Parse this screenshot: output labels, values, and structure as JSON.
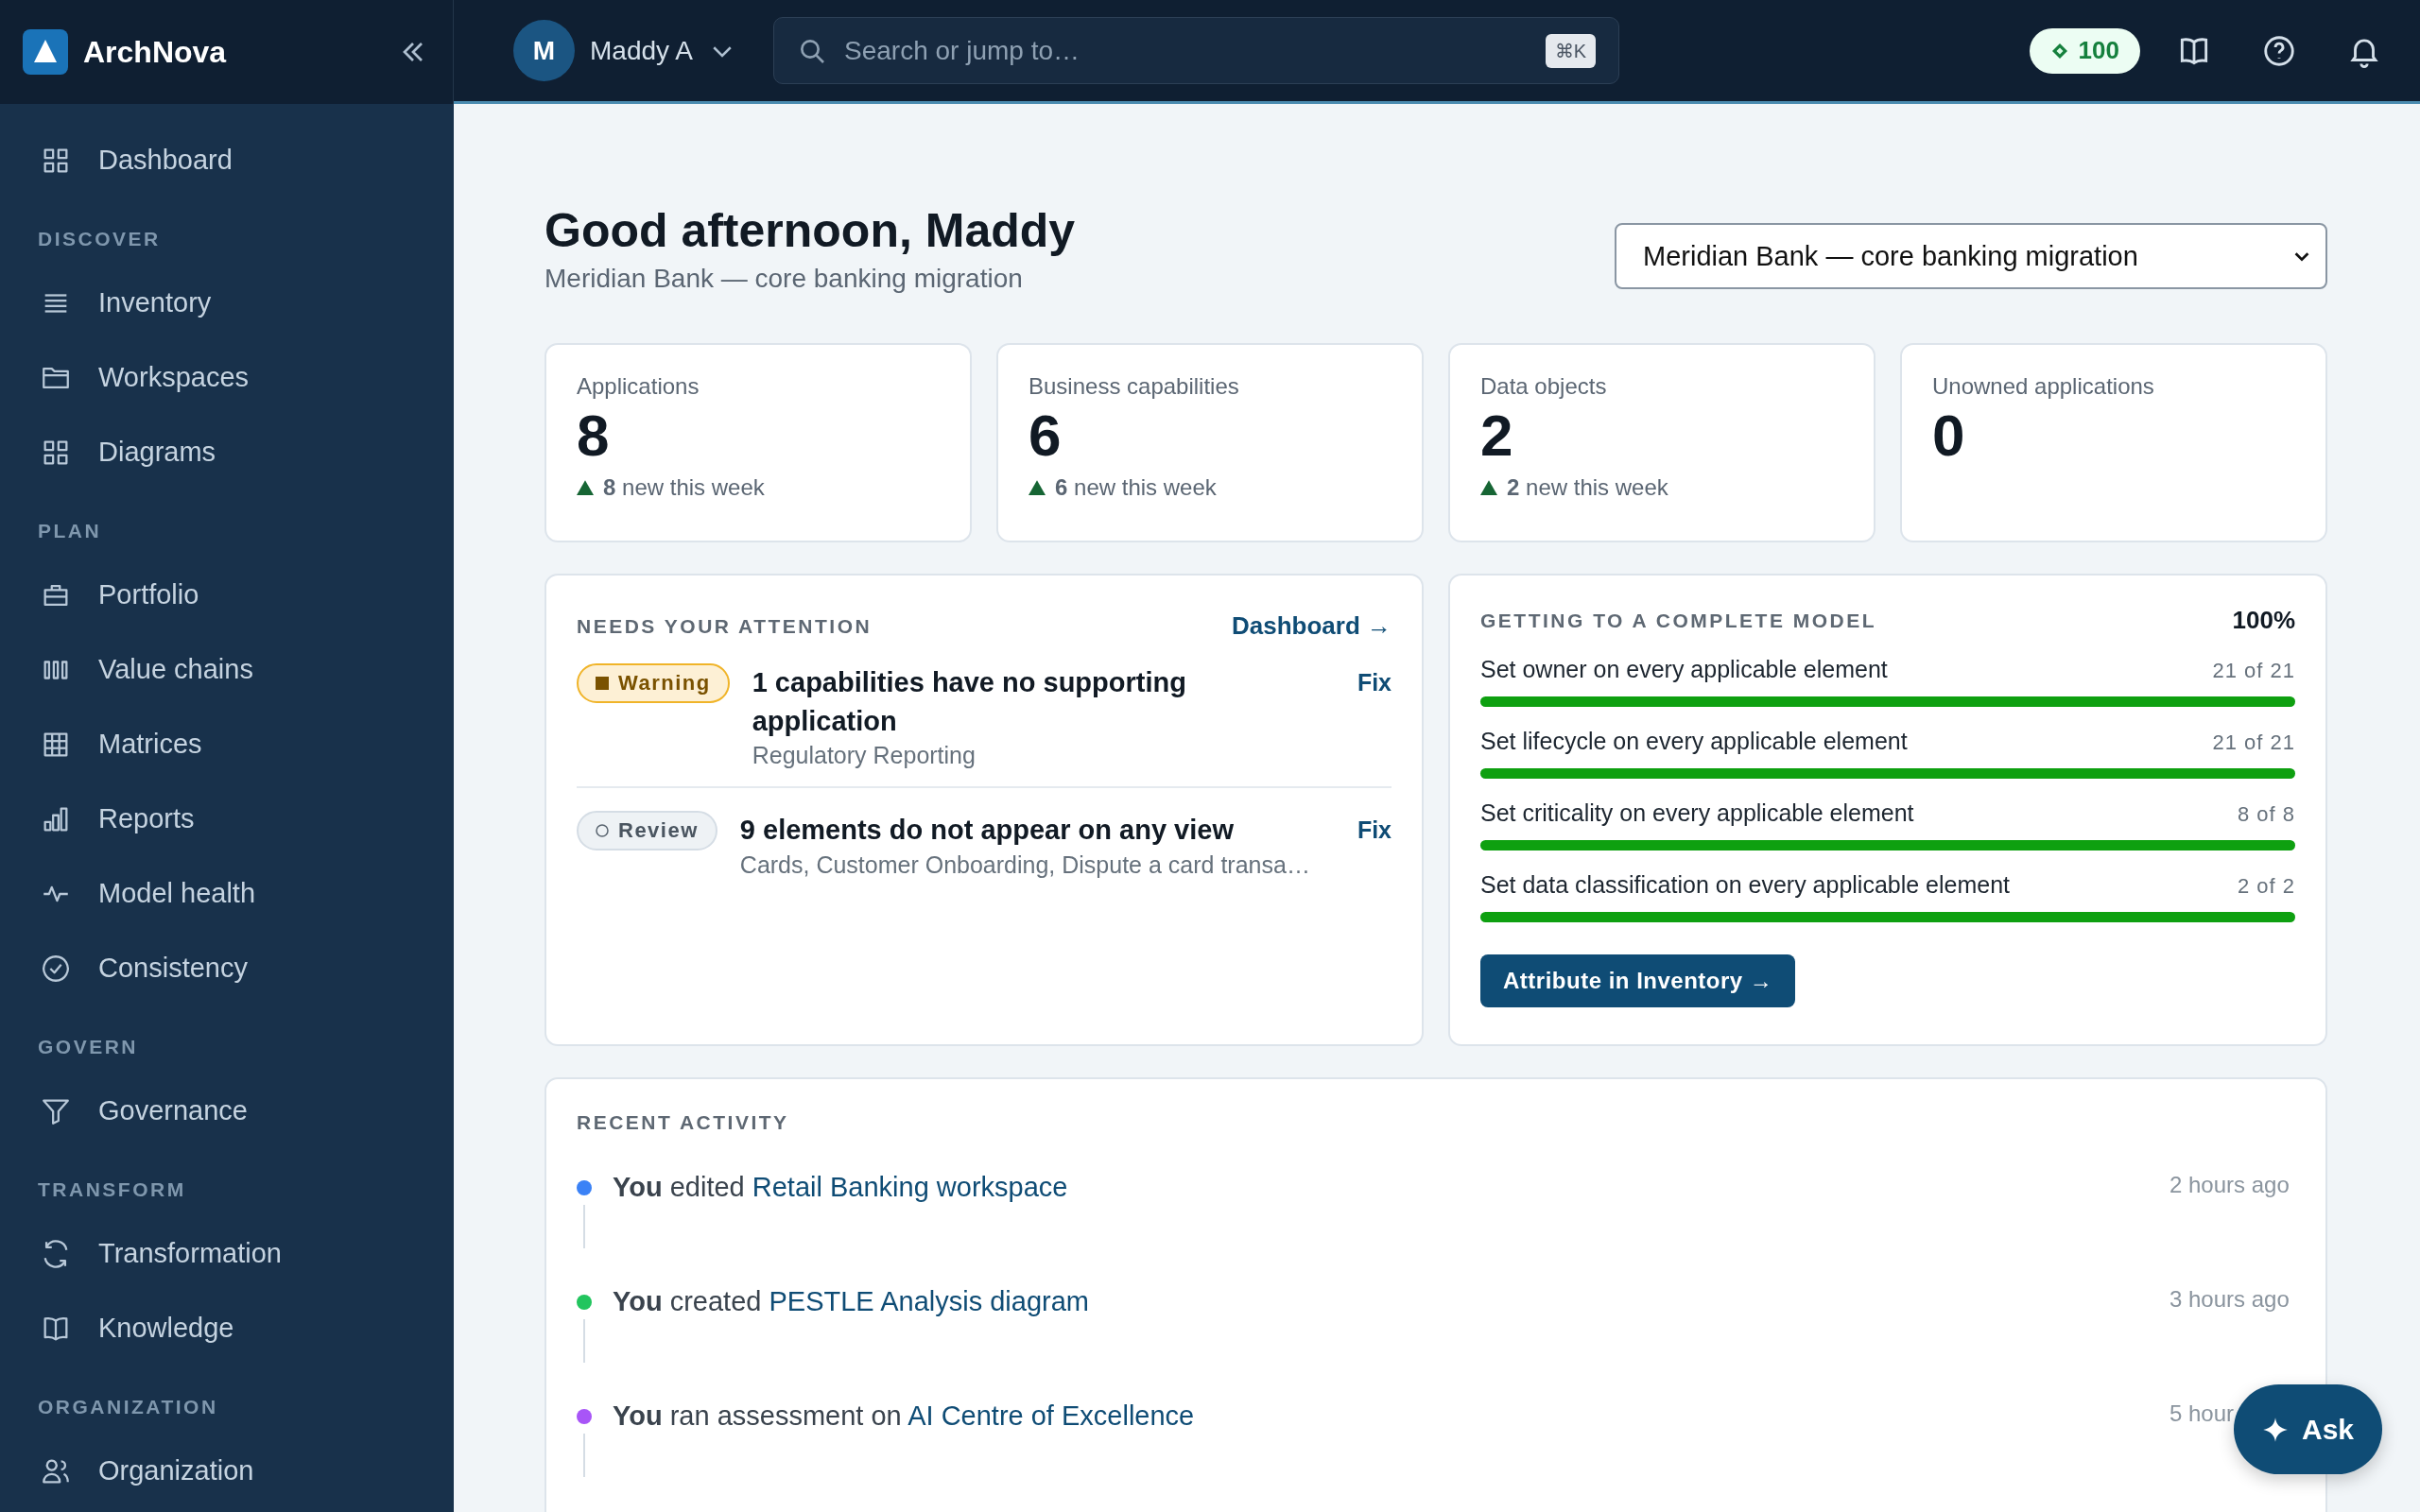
{
  "app": {
    "name": "ArchNova"
  },
  "user": {
    "initial": "M",
    "name": "Maddy A"
  },
  "search": {
    "placeholder": "Search or jump to…",
    "shortcut": "⌘K"
  },
  "points": "100",
  "sidebar": {
    "groups": [
      {
        "items": [
          {
            "label": "Dashboard"
          }
        ]
      },
      {
        "heading": "DISCOVER",
        "items": [
          {
            "label": "Inventory"
          },
          {
            "label": "Workspaces"
          },
          {
            "label": "Diagrams"
          }
        ]
      },
      {
        "heading": "PLAN",
        "items": [
          {
            "label": "Portfolio"
          },
          {
            "label": "Value chains"
          },
          {
            "label": "Matrices"
          },
          {
            "label": "Reports"
          },
          {
            "label": "Model health"
          },
          {
            "label": "Consistency"
          }
        ]
      },
      {
        "heading": "GOVERN",
        "items": [
          {
            "label": "Governance"
          }
        ]
      },
      {
        "heading": "TRANSFORM",
        "items": [
          {
            "label": "Transformation"
          },
          {
            "label": "Knowledge"
          }
        ]
      },
      {
        "heading": "ORGANIZATION",
        "items": [
          {
            "label": "Organization"
          }
        ]
      }
    ]
  },
  "greeting": {
    "title": "Good afternoon, Maddy",
    "subtitle": "Meridian Bank — core banking migration"
  },
  "project_select": {
    "value": "Meridian Bank — core banking migration"
  },
  "stats": [
    {
      "label": "Applications",
      "value": "8",
      "delta": "**8** new this week"
    },
    {
      "label": "Business capabilities",
      "value": "6",
      "delta": "**6** new this week"
    },
    {
      "label": "Data objects",
      "value": "2",
      "delta": "**2** new this week"
    },
    {
      "label": "Unowned applications",
      "value": "0"
    }
  ],
  "attention": {
    "title": "NEEDS YOUR ATTENTION",
    "link": "Dashboard →",
    "items": [
      {
        "kind": "warning",
        "badge": "Warning",
        "title": "1 capabilities have no supporting application",
        "detail": "Regulatory Reporting",
        "action": "Fix"
      },
      {
        "kind": "review",
        "badge": "Review",
        "title": "9 elements do not appear on any view",
        "detail": "Cards, Customer Onboarding, Dispute a card transa…",
        "action": "Fix"
      }
    ]
  },
  "progress": {
    "title": "GETTING TO A COMPLETE MODEL",
    "percent": "100%",
    "items": [
      {
        "label": "Set owner on every applicable element",
        "count": "21 of 21",
        "level": 1
      },
      {
        "label": "Set lifecycle on every applicable element",
        "count": "21 of 21",
        "level": 1
      },
      {
        "label": "Set criticality on every applicable element",
        "count": "8 of 8",
        "level": 1
      },
      {
        "label": "Set data classification on every applicable element",
        "count": "2 of 2",
        "level": 1
      }
    ],
    "button": "Attribute in Inventory →"
  },
  "activity": {
    "title": "RECENT ACTIVITY",
    "items": [
      {
        "text": "**You** edited",
        "link": "Retail Banking workspace",
        "time": "2 hours ago",
        "color": "#3b82f6"
      },
      {
        "text": "**You** created",
        "link": "PESTLE Analysis diagram",
        "time": "3 hours ago",
        "color": "#22c55e"
      },
      {
        "text": "**You** ran assessment on",
        "link": "AI Centre of Excellence",
        "time": "5 hour",
        "color": "#a855f7"
      }
    ]
  },
  "ask": {
    "label": "Ask"
  }
}
